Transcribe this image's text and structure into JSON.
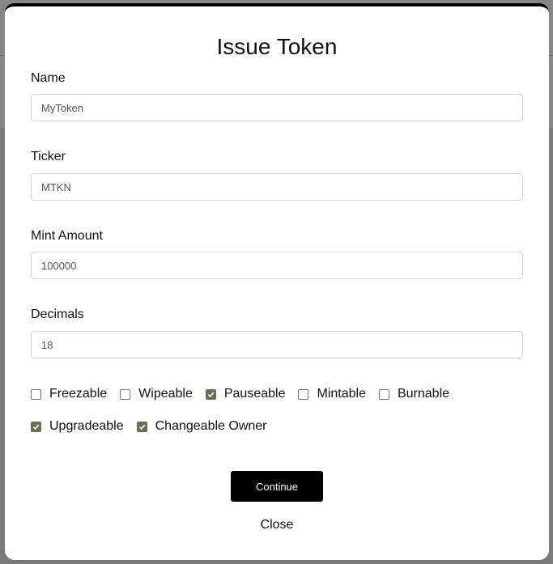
{
  "modal": {
    "title": "Issue Token",
    "fields": [
      {
        "label": "Name",
        "value": "MyToken"
      },
      {
        "label": "Ticker",
        "value": "MTKN"
      },
      {
        "label": "Mint Amount",
        "value": "100000"
      },
      {
        "label": "Decimals",
        "value": "18"
      }
    ],
    "options": [
      {
        "label": "Freezable",
        "checked": false
      },
      {
        "label": "Wipeable",
        "checked": false
      },
      {
        "label": "Pauseable",
        "checked": true
      },
      {
        "label": "Mintable",
        "checked": false
      },
      {
        "label": "Burnable",
        "checked": false
      },
      {
        "label": "Upgradeable",
        "checked": true
      },
      {
        "label": "Changeable Owner",
        "checked": true
      }
    ],
    "continue_label": "Continue",
    "close_label": "Close"
  },
  "colors": {
    "checkbox_checked": "#6f6b55",
    "primary_button": "#000000"
  }
}
